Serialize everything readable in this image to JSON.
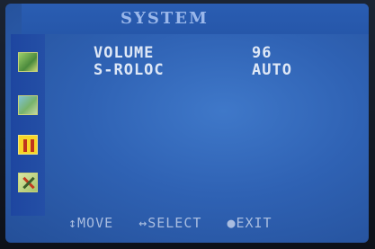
{
  "osd": {
    "title": "SYSTEM",
    "items": [
      {
        "label": "VOLUME",
        "value": "96"
      },
      {
        "label": "S-ROLOC",
        "value": "AUTO"
      }
    ],
    "sidebar_icons": [
      "picture-icon",
      "image-settings-icon",
      "tools-icon",
      "system-icon"
    ],
    "footer": {
      "move": "↕MOVE",
      "select": "↔SELECT",
      "exit": "●EXIT"
    },
    "colors": {
      "screen": "#2f62b4",
      "sidebar": "#1e46a0",
      "text": "#dfe8f6",
      "title": "#9ab7ea"
    }
  }
}
